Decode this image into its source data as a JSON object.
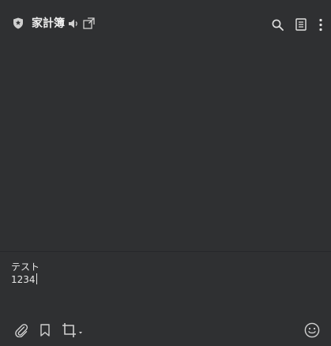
{
  "header": {
    "title": "家計簿",
    "icons": {
      "badge": "shield-star-icon",
      "speaker": "speaker-icon",
      "popout": "popout-icon",
      "search": "search-icon",
      "notes": "notes-icon",
      "more": "more-vertical-icon"
    }
  },
  "composer": {
    "lines": [
      "テスト",
      "1234"
    ]
  },
  "toolbar": {
    "icons": {
      "attach": "paperclip-icon",
      "bookmark": "bookmark-icon",
      "crop": "crop-icon",
      "crop_menu": "caret-down-icon",
      "emoji": "emoji-icon"
    }
  },
  "colors": {
    "background": "#2f3032",
    "text": "#e6e6e6",
    "icon": "#d0d0d0",
    "divider": "#26272a"
  }
}
